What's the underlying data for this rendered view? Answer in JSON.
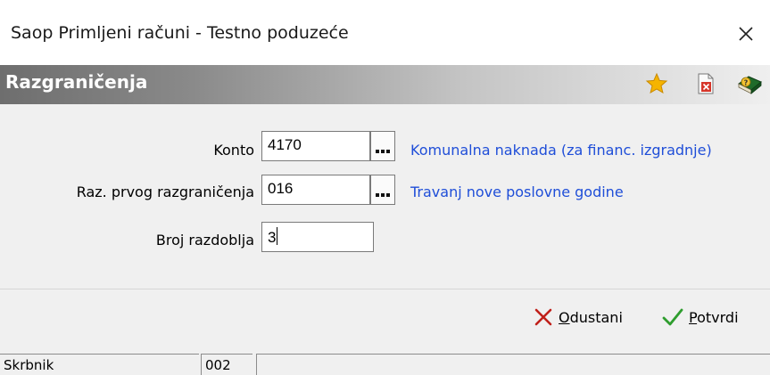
{
  "window": {
    "title": "Saop Primljeni računi - Testno poduzeće",
    "close_icon": "close-icon"
  },
  "header": {
    "title": "Razgraničenja",
    "icons": [
      "star-icon",
      "delete-document-icon",
      "help-book-icon"
    ]
  },
  "form": {
    "konto": {
      "label": "Konto",
      "value": "4170",
      "description": "Komunalna naknada (za financ. izgradnje)"
    },
    "prvo_razgranicenje": {
      "label": "Raz. prvog razgraničenja",
      "value": "016",
      "description": "Travanj nove poslovne godine"
    },
    "broj_razdoblja": {
      "label": "Broj razdoblja",
      "value": "3"
    }
  },
  "actions": {
    "cancel": {
      "label_prefix": "",
      "label_underline": "O",
      "label_rest": "dustani"
    },
    "confirm": {
      "label_prefix": "",
      "label_underline": "P",
      "label_rest": "otvrdi"
    }
  },
  "status": {
    "user": "Skrbnik",
    "code": "002",
    "message": ""
  },
  "colors": {
    "link_blue": "#1f4ed8",
    "cancel_red": "#c0201a",
    "confirm_green": "#2e9d2e",
    "star_gold": "#f5b400"
  }
}
